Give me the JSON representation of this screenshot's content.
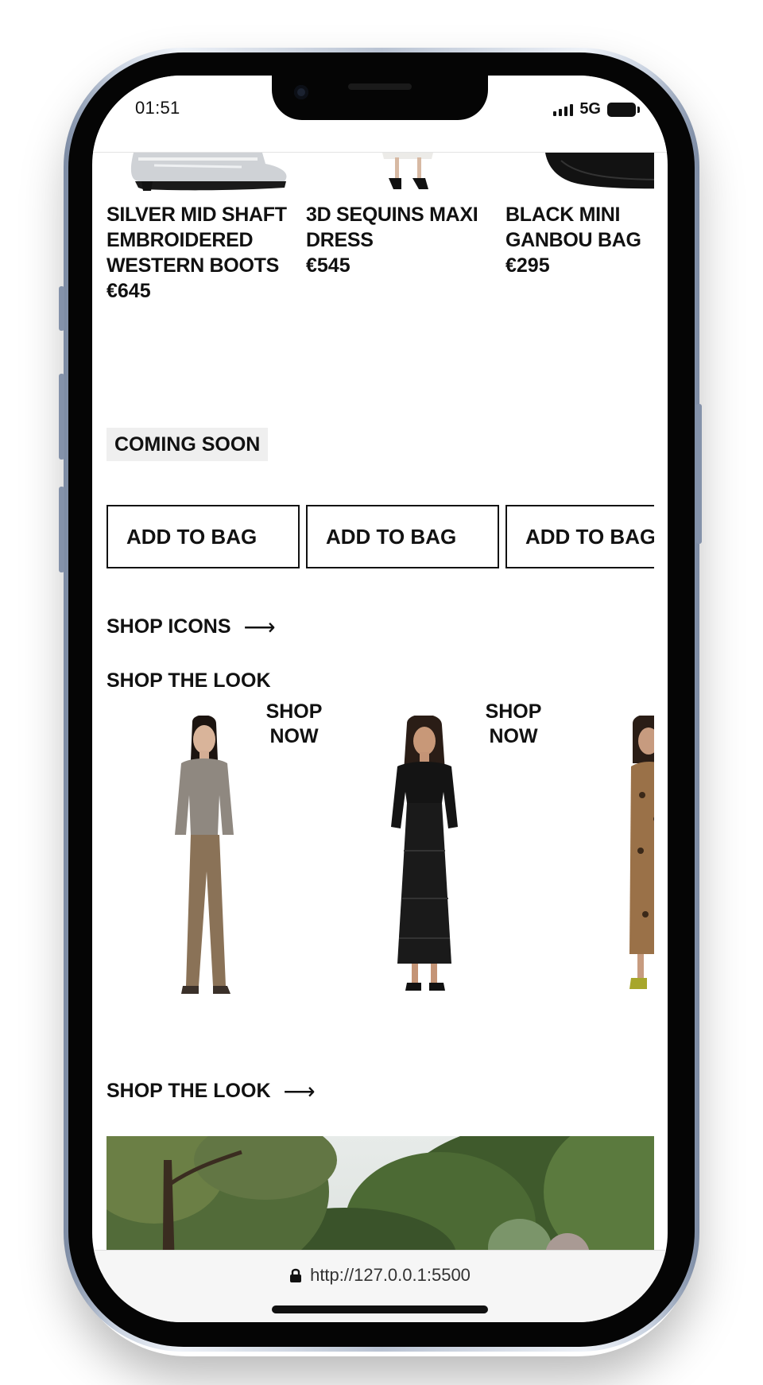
{
  "status_bar": {
    "time": "01:51",
    "network": "5G"
  },
  "products": [
    {
      "title": "SILVER MID SHAFT EMBROIDERED WESTERN BOOTS",
      "price": "€645"
    },
    {
      "title": "3D SEQUINS MAXI DRESS",
      "price": "€545"
    },
    {
      "title": "BLACK MINI GANBOU BAG",
      "price": "€295"
    }
  ],
  "coming_soon_label": "COMING SOON",
  "add_to_bag_label": "ADD TO BAG",
  "shop_icons_label": "SHOP ICONS",
  "shop_the_look_heading": "SHOP THE LOOK",
  "shop_now_label": "SHOP NOW",
  "shop_the_look_link_label": "SHOP THE LOOK",
  "browser": {
    "url": "http://127.0.0.1:5500"
  },
  "colors": {
    "text": "#111111",
    "chip_bg": "#efefef",
    "border": "#111111",
    "frame": "#050505"
  },
  "icons": [
    "lock-icon",
    "arrow-right-icon",
    "signal-icon",
    "battery-icon"
  ]
}
